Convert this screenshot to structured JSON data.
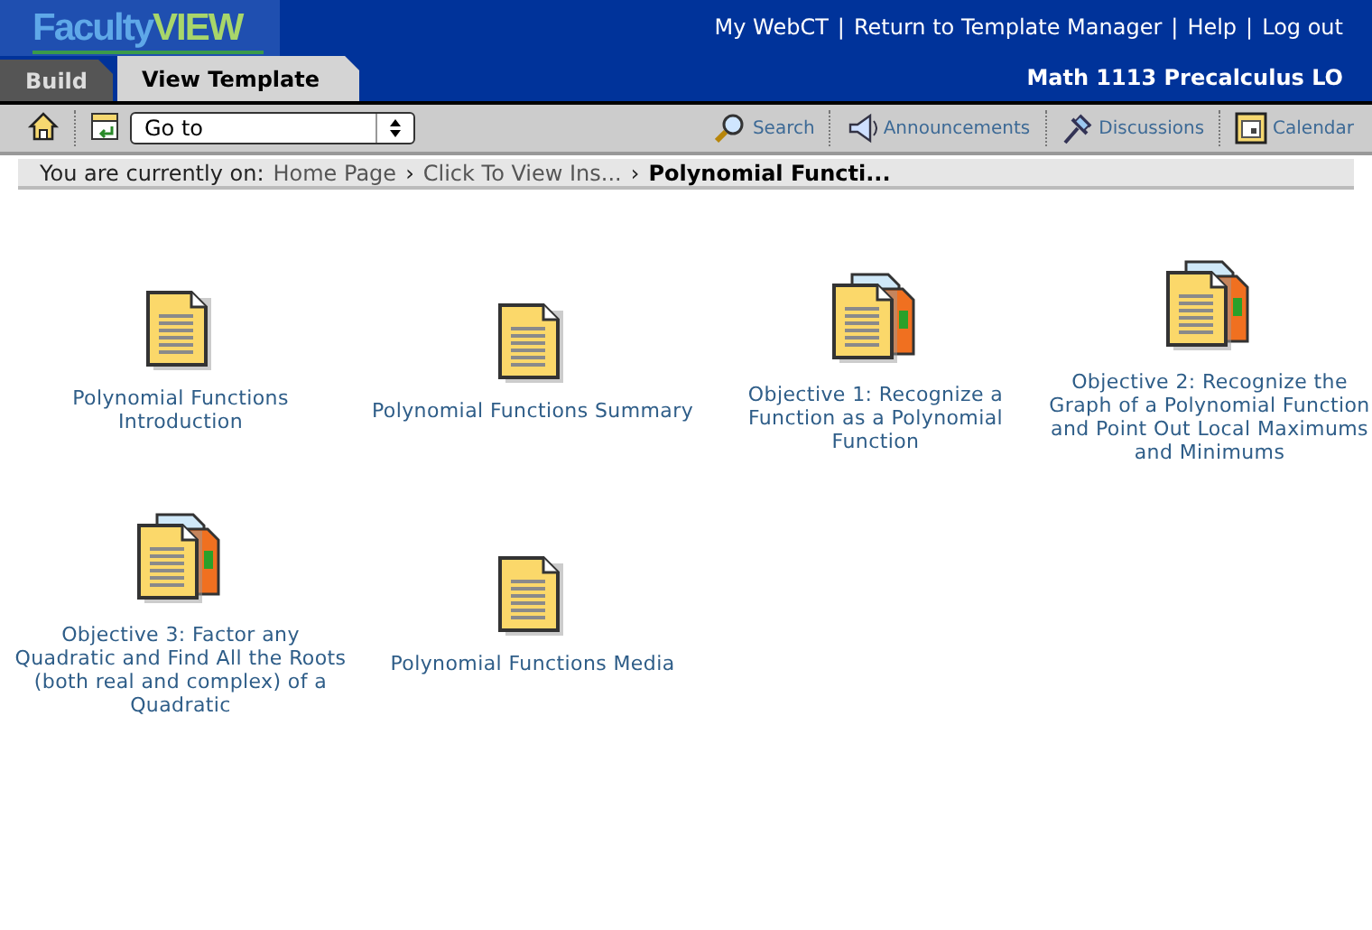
{
  "header": {
    "logo": {
      "part1": "Faculty",
      "part2": "VIEW"
    },
    "links": [
      "My WebCT",
      "Return to Template Manager",
      "Help",
      "Log out"
    ],
    "separator": "|",
    "course": "Math 1113 Precalculus LO"
  },
  "tabs": [
    {
      "label": "Build",
      "selected": false
    },
    {
      "label": "View Template",
      "selected": true
    }
  ],
  "toolbar": {
    "goto": {
      "value": "Go to"
    },
    "tools": [
      {
        "label": "Search",
        "kind": "search"
      },
      {
        "label": "Announcements",
        "kind": "announce"
      },
      {
        "label": "Discussions",
        "kind": "pin"
      },
      {
        "label": "Calendar",
        "kind": "calendar"
      }
    ]
  },
  "breadcrumb": {
    "label": "You are currently on:",
    "links": [
      "Home Page",
      "Click To View Ins..."
    ],
    "separator": "›",
    "current": "Polynomial Functi..."
  },
  "items": [
    {
      "kind": "page",
      "label": "Polynomial Functions Introduction"
    },
    {
      "kind": "page",
      "label": "Polynomial Functions Summary"
    },
    {
      "kind": "multi",
      "label": "Objective 1: Recognize a Function as a Polynomial Function"
    },
    {
      "kind": "multi",
      "label": "Objective 2: Recognize the Graph of a Polynomial Function and Point Out Local Maximums and Minimums"
    },
    {
      "kind": "multi",
      "label": "Objective 3: Factor any Quadratic and Find All the Roots (both real and complex) of a Quadratic"
    },
    {
      "kind": "page",
      "label": "Polynomial Functions Media"
    }
  ]
}
